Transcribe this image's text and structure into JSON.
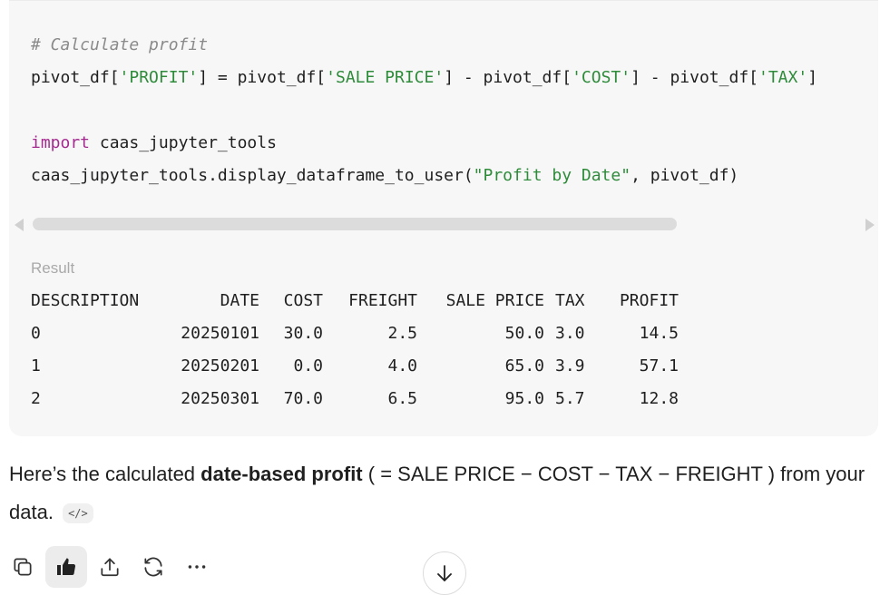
{
  "code": {
    "comment": "# Calculate profit",
    "line2": {
      "a": "pivot_df[",
      "s1": "'PROFIT'",
      "b": "] = pivot_df[",
      "s2": "'SALE PRICE'",
      "c": "] - pivot_df[",
      "s3": "'COST'",
      "d": "] - pivot_df[",
      "s4": "'TAX'",
      "e": "]"
    },
    "import_kw": "import",
    "import_mod": " caas_jupyter_tools",
    "call_pre": "caas_jupyter_tools.display_dataframe_to_user(",
    "call_str": "\"Profit by Date\"",
    "call_post": ", pivot_df)"
  },
  "result": {
    "label": "Result",
    "headers": [
      "DESCRIPTION",
      "DATE",
      "COST",
      "FREIGHT",
      "SALE PRICE",
      "TAX",
      "PROFIT"
    ],
    "rows": [
      [
        "0",
        "20250101",
        "30.0",
        "2.5",
        "50.0",
        "3.0",
        "14.5"
      ],
      [
        "1",
        "20250201",
        "0.0",
        "4.0",
        "65.0",
        "3.9",
        "57.1"
      ],
      [
        "2",
        "20250301",
        "70.0",
        "6.5",
        "95.0",
        "5.7",
        "12.8"
      ]
    ]
  },
  "message": {
    "pre": "Here’s the calculated ",
    "bold": "date-based profit",
    "post": " ( = SALE PRICE − COST − TAX − FREIGHT ) from your data.",
    "chip": "</>"
  },
  "icons": {
    "copy": "copy-icon",
    "like": "thumbs-up-icon",
    "share": "share-icon",
    "regen": "regenerate-icon",
    "more": "more-icon",
    "down": "arrow-down-icon"
  }
}
